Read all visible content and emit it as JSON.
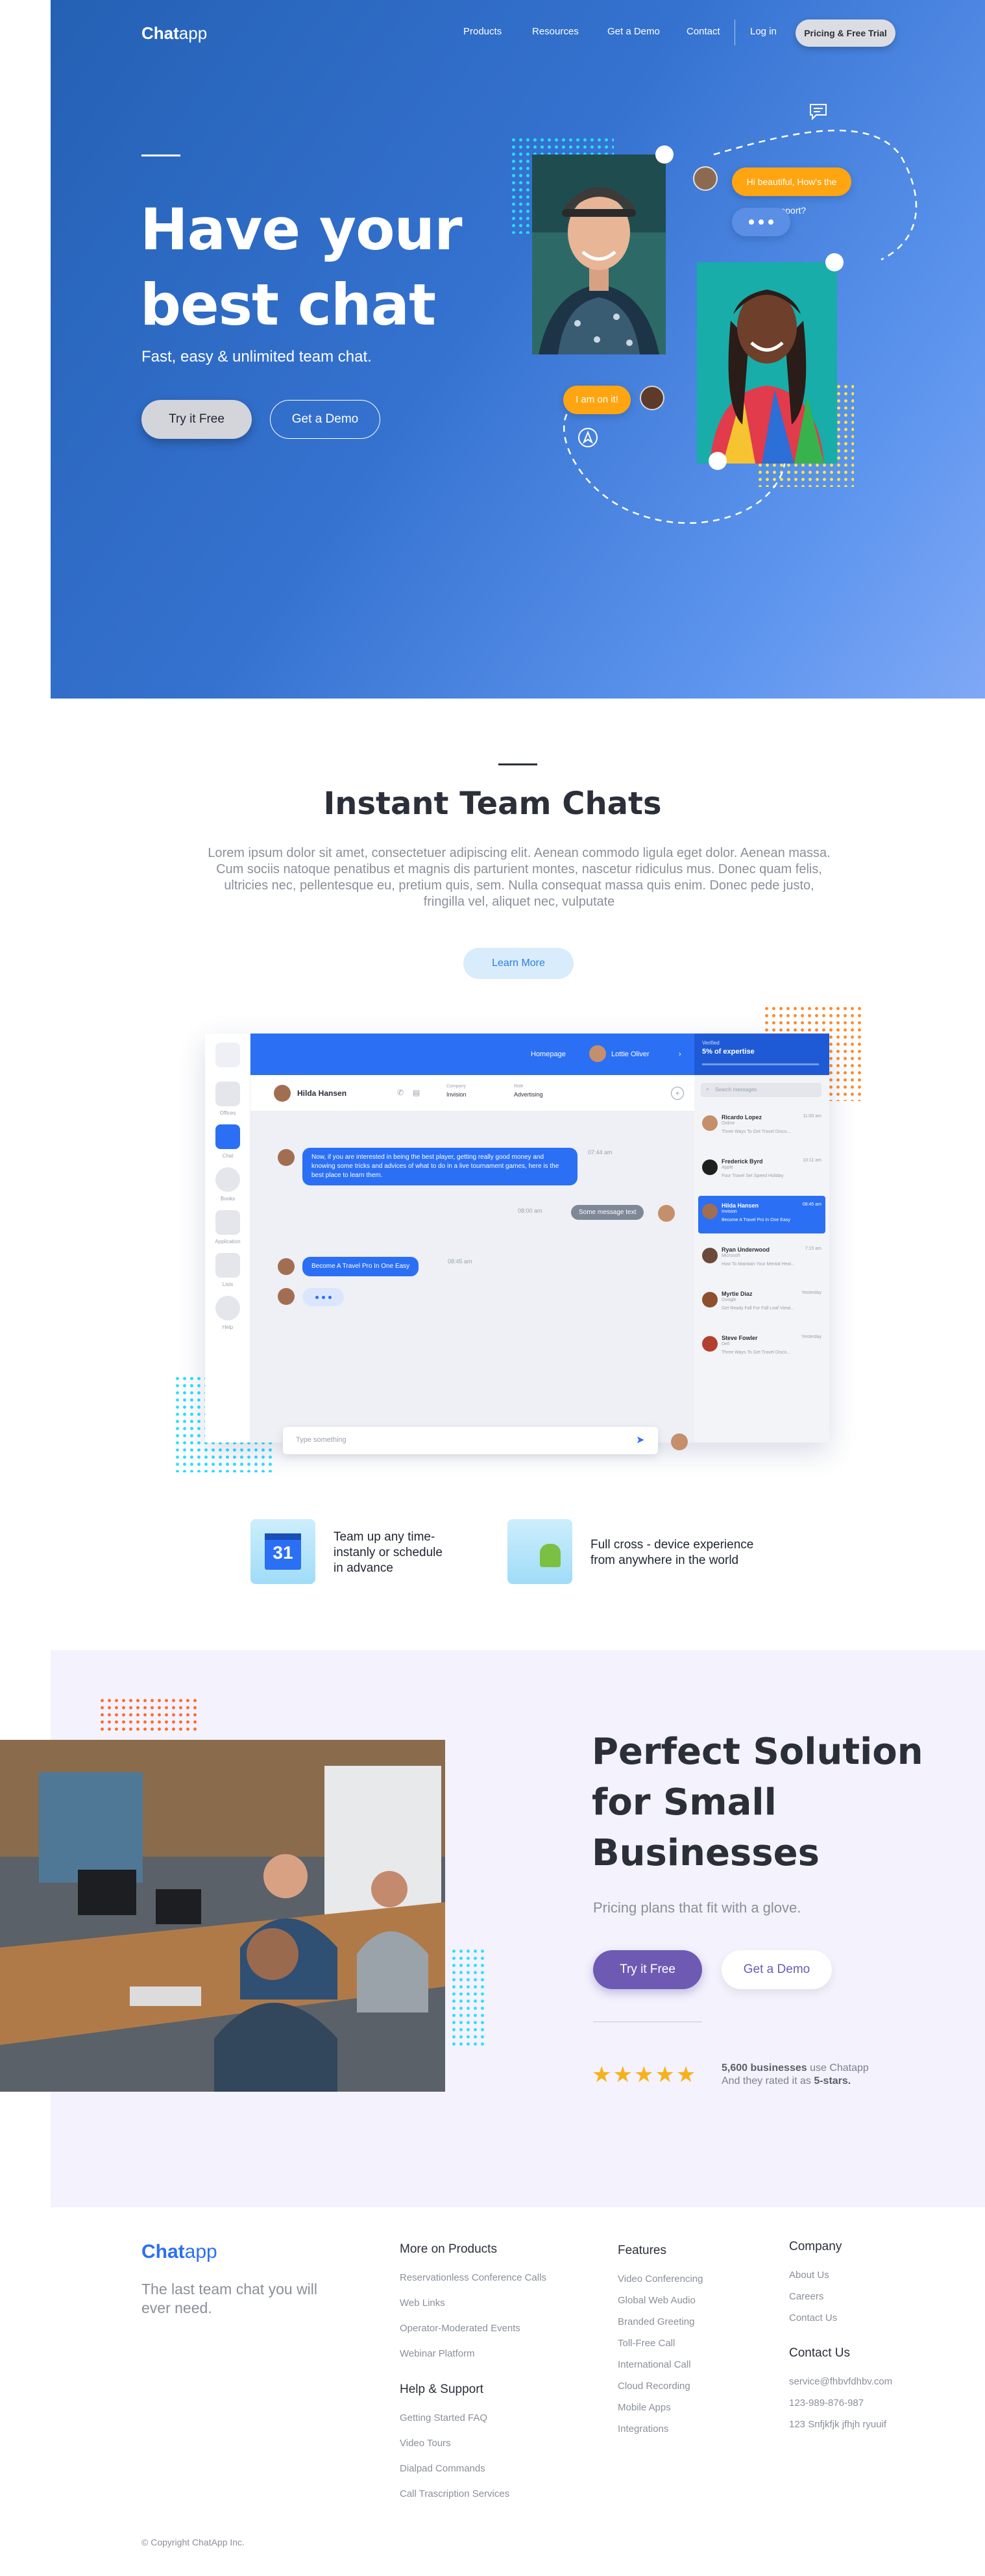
{
  "nav": {
    "logo_bold": "Chat",
    "logo_light": "app",
    "links": [
      "Products",
      "Resources",
      "Get a Demo",
      "Contact",
      "Log in"
    ],
    "cta": "Pricing & Free Trial"
  },
  "hero": {
    "title_line1": "Have your",
    "title_line2": "best chat",
    "subtitle": "Fast, easy & unlimited team chat.",
    "try_button": "Try it Free",
    "demo_button": "Get a Demo",
    "bubble_report": "Hi beautiful, How's the report?",
    "bubble_reply": "I am on it!"
  },
  "section2": {
    "title": "Instant Team Chats",
    "body": "Lorem ipsum dolor sit amet, consectetuer adipiscing elit. Aenean commodo ligula eget dolor. Aenean massa. Cum sociis natoque penatibus et magnis dis parturient montes, nascetur ridiculus mus. Donec quam felis, ultricies nec, pellentesque eu, pretium quis, sem. Nulla consequat massa quis enim. Donec pede justo, fringilla vel, aliquet nec, vulputate",
    "learn_button": "Learn More"
  },
  "app": {
    "rail": [
      "Offices",
      "Chat",
      "Books",
      "Application",
      "Lists",
      "Help"
    ],
    "top_homepage": "Homepage",
    "top_user": "Lottie Oliver",
    "top_right_label": "Verified",
    "top_right_value": "5% of expertise",
    "contact_name": "Hilda Hansen",
    "company_label": "Company",
    "company_value": "Invision",
    "role_label": "Role",
    "role_value": "Advertising",
    "search_placeholder": "Search messages",
    "msg1": "Now, if you are interested in being the best player, getting really good money and knowing some tricks and advices of what to do in a live tournament games, here is the best place to learn them.",
    "msg1_time": "07:44 am",
    "msg2": "Some message text",
    "msg2_time": "08:00 am",
    "msg3": "Become A Travel Pro In One Easy",
    "msg3_time": "08:45 am",
    "type_placeholder": "Type something",
    "list": [
      {
        "name": "Ricardo Lopez",
        "role": "Online",
        "msg": "Three Ways To Get Travel Disco...",
        "time": "11:00 am"
      },
      {
        "name": "Frederick Byrd",
        "role": "Apple",
        "msg": "Four Travel Set Speed Holiday",
        "time": "10:11 am"
      },
      {
        "name": "Hilda Hansen",
        "role": "Invision",
        "msg": "Become A Travel Pro In One Easy",
        "time": "08:45 am"
      },
      {
        "name": "Ryan Underwood",
        "role": "Microsoft",
        "msg": "How To Maintain Your Mental Heal...",
        "time": "7:15 am"
      },
      {
        "name": "Myrtie Diaz",
        "role": "Google",
        "msg": "Get Ready Fall For Fall Leaf Viewi...",
        "time": "Yesterday"
      },
      {
        "name": "Steve Fowler",
        "role": "Dell",
        "msg": "Three Ways To Get Travel Disco...",
        "time": "Yesterday"
      }
    ]
  },
  "features": {
    "calendar_day": "31",
    "f1": [
      "Team up any time-",
      "instanly or schedule",
      "in advance"
    ],
    "f2": [
      "Full cross - device experience",
      "from anywhere in the world"
    ]
  },
  "section3": {
    "title": [
      "Perfect Solution",
      "for Small",
      "Businesses"
    ],
    "subtitle": "Pricing plans that fit with a glove.",
    "try_button": "Try it Free",
    "demo_button": "Get a Demo",
    "stars": "★★★★★",
    "rating_count": "5,600 businesses",
    "rating_use": " use Chatapp",
    "rating_line2": "And they rated it as ",
    "rating_stars_word": "5-stars."
  },
  "footer": {
    "logo_bold": "Chat",
    "logo_light": "app",
    "tagline": "The last team chat you will ever need.",
    "products_head": "More on Products",
    "products": [
      "Reservationless Conference Calls",
      "Web Links",
      "Operator-Moderated Events",
      "Webinar Platform"
    ],
    "support_head": "Help & Support",
    "support": [
      "Getting Started FAQ",
      "Video Tours",
      "Dialpad Commands",
      "Call Trascription Services"
    ],
    "features_head": "Features",
    "features": [
      "Video Conferencing",
      "Global Web Audio",
      "Branded Greeting",
      "Toll-Free Call",
      "International Call",
      "Cloud Recording",
      "Mobile Apps",
      "Integrations"
    ],
    "company_head": "Company",
    "company": [
      "About Us",
      "Careers",
      "Contact Us"
    ],
    "contact_head": "Contact Us",
    "contact": [
      "service@fhbvfdhbv.com",
      "123-989-876-987",
      "123 Snfjkfjk jfhjh ryuuif"
    ],
    "copyright": "© Copyright ChatApp Inc."
  },
  "colors": {
    "hero_blue": "#2f6cc8",
    "accent_blue": "#2b6ff4",
    "orange": "#ffa511",
    "purple": "#6e5ab3",
    "star": "#f6b21d",
    "section3_bg": "#f3f2fd"
  }
}
